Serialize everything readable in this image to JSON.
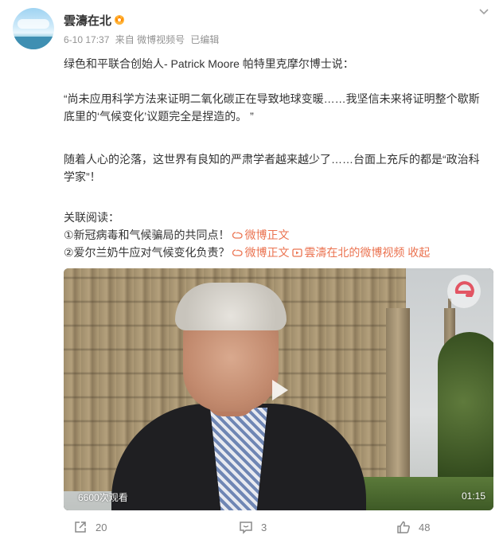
{
  "post": {
    "author": "雲濤在北",
    "time": "6-10 17:37",
    "source": "来自 微博视频号",
    "edited": "已编辑",
    "paragraphs": {
      "p1": "绿色和平联合创始人- Patrick Moore 帕特里克摩尔博士说：",
      "p2": "“尚未应用科学方法来证明二氧化碳正在导致地球变暖……我坚信未来将证明整个歇斯底里的‘气候变化’议题完全是捏造的。 ”",
      "p3": "随着人心的沦落，这世界有良知的严肃学者越来越少了……台面上充斥的都是“政治科学家”！"
    },
    "related": {
      "heading": "关联阅读：",
      "item1_text": "①新冠病毒和气候骗局的共同点！",
      "item1_link": "微博正文",
      "item2_text": "②爱尔兰奶牛应对气候变化负责？",
      "item2_link": "微博正文",
      "item2_link2": "雲濤在北的微博视频",
      "collapse": "收起"
    }
  },
  "video": {
    "views": "6600次观看",
    "duration": "01:15"
  },
  "actions": {
    "share": "20",
    "comment": "3",
    "like": "48"
  },
  "colors": {
    "link": "#eb7350",
    "meta": "#939393",
    "text": "#333333"
  },
  "icons": [
    "vip-crown-icon",
    "chevron-down-icon",
    "link-icon",
    "play-icon",
    "share-icon",
    "comment-icon",
    "like-icon",
    "channel-logo-icon"
  ]
}
